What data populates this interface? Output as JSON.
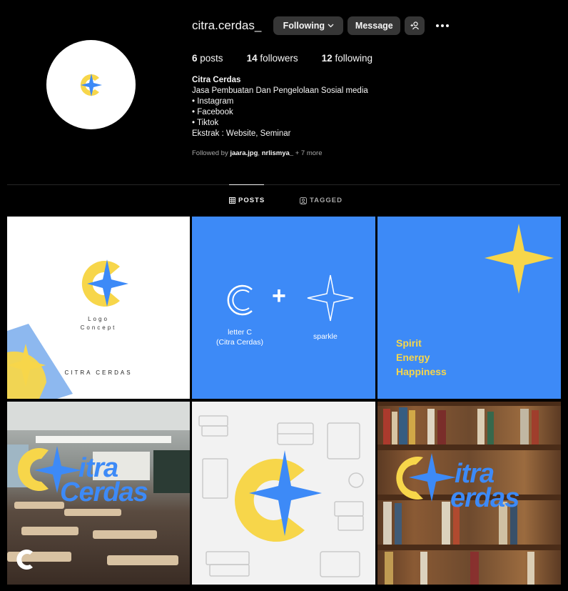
{
  "profile": {
    "username": "citra.cerdas_",
    "following_btn": "Following",
    "message_btn": "Message",
    "stats": {
      "posts_count": "6",
      "posts_label": "posts",
      "followers_count": "14",
      "followers_label": "followers",
      "following_count": "12",
      "following_label": "following"
    },
    "bio": {
      "name": "Citra Cerdas",
      "lines": [
        "Jasa Pembuatan Dan Pengelolaan Sosial media",
        "• Instagram",
        "• Facebook",
        "• Tiktok",
        "Ekstrak : Website, Seminar"
      ]
    },
    "followed_by": {
      "prefix": "Followed by ",
      "user1": "jaara.jpg",
      "sep": ", ",
      "user2": "nrlismya_",
      "suffix": " + 7 more"
    }
  },
  "tabs": {
    "posts": "POSTS",
    "tagged": "TAGGED"
  },
  "posts": {
    "p1": {
      "line1": "Logo",
      "line2": "Concept",
      "brand": "CITRA CERDAS"
    },
    "p2": {
      "plus": "+",
      "label_c_1": "letter C",
      "label_c_2": "(Citra Cerdas)",
      "label_sparkle": "sparkle"
    },
    "p3": {
      "line1": "Spirit",
      "line2": "Energy",
      "line3": "Happiness"
    },
    "p4": {
      "w1": "itra",
      "w2": "Cerdas"
    },
    "p6": {
      "w1": "itra",
      "w2": "erdas"
    }
  },
  "colors": {
    "accent_blue": "#3d8af7",
    "accent_yellow": "#f7d64a",
    "button_bg": "#363636"
  }
}
